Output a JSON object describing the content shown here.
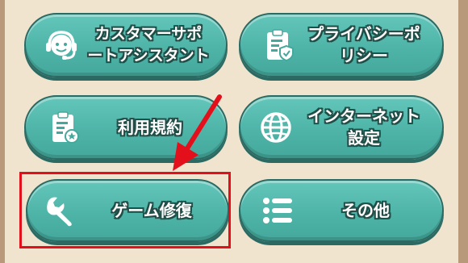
{
  "buttons": {
    "support": {
      "label": "カスタマーサポ\nートアシスタント",
      "icon": "headset-support-icon"
    },
    "privacy": {
      "label": "プライバシーポ\nリシー",
      "icon": "clipboard-shield-icon"
    },
    "terms": {
      "label": "利用規約",
      "icon": "clipboard-badge-icon"
    },
    "internet": {
      "label": "インターネット\n設定",
      "icon": "globe-icon"
    },
    "repair": {
      "label": "ゲーム修復",
      "icon": "wrench-icon"
    },
    "other": {
      "label": "その他",
      "icon": "list-icon"
    }
  },
  "colors": {
    "button_fill": "#52b8ac",
    "button_border": "#2b6a62",
    "highlight": "#e3101c",
    "panel": "#f0e4cf"
  }
}
